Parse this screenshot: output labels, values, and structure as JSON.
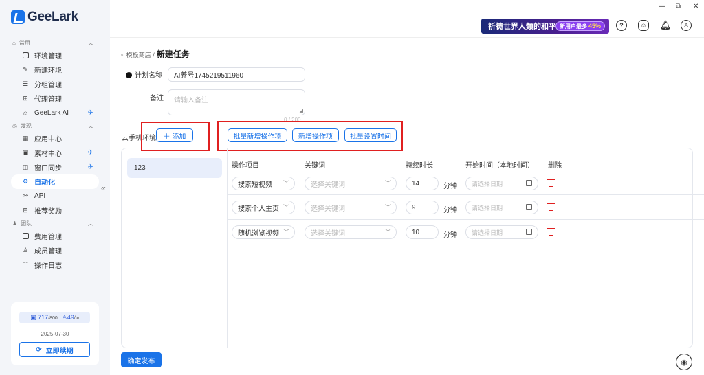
{
  "app": {
    "name": "GeeLark"
  },
  "sidebar": {
    "sections": [
      {
        "label": "常用",
        "items": [
          {
            "label": "环境管理",
            "icon": "environment-icon"
          },
          {
            "label": "新建环境",
            "icon": "edit-icon"
          },
          {
            "label": "分组管理",
            "icon": "list-icon"
          },
          {
            "label": "代理管理",
            "icon": "proxy-icon"
          },
          {
            "label": "GeeLark AI",
            "icon": "robot-icon"
          }
        ]
      },
      {
        "label": "发现",
        "items": [
          {
            "label": "应用中心",
            "icon": "grid-icon"
          },
          {
            "label": "素材中心",
            "icon": "media-icon"
          },
          {
            "label": "窗口同步",
            "icon": "window-icon"
          },
          {
            "label": "自动化",
            "icon": "automation-icon"
          },
          {
            "label": "API",
            "icon": "api-icon"
          },
          {
            "label": "推荐奖励",
            "icon": "gift-icon"
          }
        ]
      },
      {
        "label": "团队",
        "items": [
          {
            "label": "费用管理",
            "icon": "wallet-icon"
          },
          {
            "label": "成员管理",
            "icon": "user-icon"
          },
          {
            "label": "操作日志",
            "icon": "log-icon"
          }
        ]
      }
    ],
    "active_item": "自动化",
    "subscription": {
      "env_used": "717",
      "env_total": "/800",
      "members_used": "49",
      "members_total": "/∞",
      "expire_date": "2025-07-30",
      "renew_label": "立即续期"
    }
  },
  "header": {
    "banner": {
      "text": "祈祷世界人類的和平",
      "pill_prefix": "新用户最多",
      "pill_value": "45%"
    }
  },
  "page": {
    "breadcrumb_parent": "< 模板商店 /",
    "title": "新建任务",
    "plan_name_label": "计划名称",
    "plan_name_value": "AI养号1745219511960",
    "note_label": "备注",
    "note_placeholder": "请输入备注",
    "note_counter": "0 / 200",
    "env_label": "云手机环境",
    "add_label": "＋ 添加",
    "batch_add_label": "批量新增操作项",
    "add_op_label": "新增操作项",
    "batch_time_label": "批量设置时间",
    "environments": [
      "123"
    ],
    "table": {
      "headers": [
        "操作项目",
        "关键词",
        "持续时长",
        "开始时间（本地时间）",
        "删除"
      ],
      "keyword_placeholder": "选择关键词",
      "date_placeholder": "请选择日期",
      "unit": "分钟",
      "rows": [
        {
          "operation": "搜索短视频",
          "duration": "14"
        },
        {
          "operation": "搜索个人主页",
          "duration": "9"
        },
        {
          "operation": "随机浏览视频",
          "duration": "10"
        }
      ]
    },
    "publish_label": "确定发布"
  },
  "colors": {
    "accent": "#1a73e8",
    "highlight": "#e02020",
    "sidebar_bg": "#f3f5f9"
  }
}
